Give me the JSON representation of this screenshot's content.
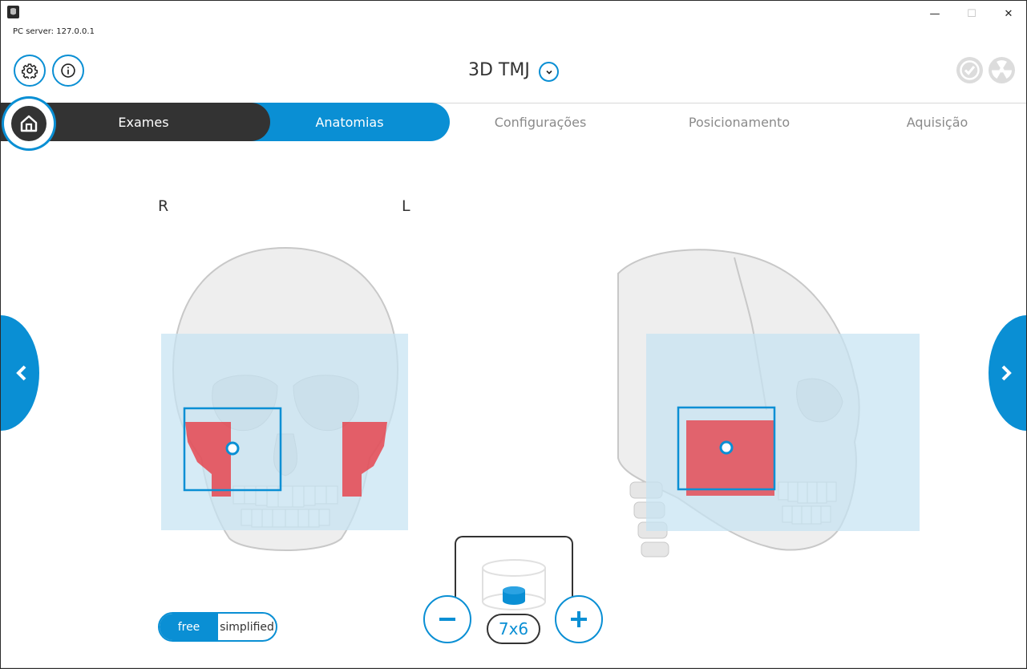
{
  "window": {
    "server_info": "PC server: 127.0.0.1",
    "min_glyph": "—",
    "max_glyph": "☐",
    "close_glyph": "✕"
  },
  "header": {
    "mode_title": "3D TMJ"
  },
  "steps": {
    "exames": "Exames",
    "anatomias": "Anatomias",
    "configuracoes": "Configurações",
    "posicionamento": "Posicionamento",
    "aquisicao": "Aquisição"
  },
  "anatomy": {
    "label_right": "R",
    "label_left": "L"
  },
  "fov": {
    "size": "7x6",
    "minus": "−",
    "plus": "+"
  },
  "toggle": {
    "free": "free",
    "simplified": "simplified"
  },
  "colors": {
    "accent": "#0a8fd4",
    "dark": "#333333",
    "fov_overlay": "#cfe7f3",
    "tmj_region": "#e8303a"
  }
}
